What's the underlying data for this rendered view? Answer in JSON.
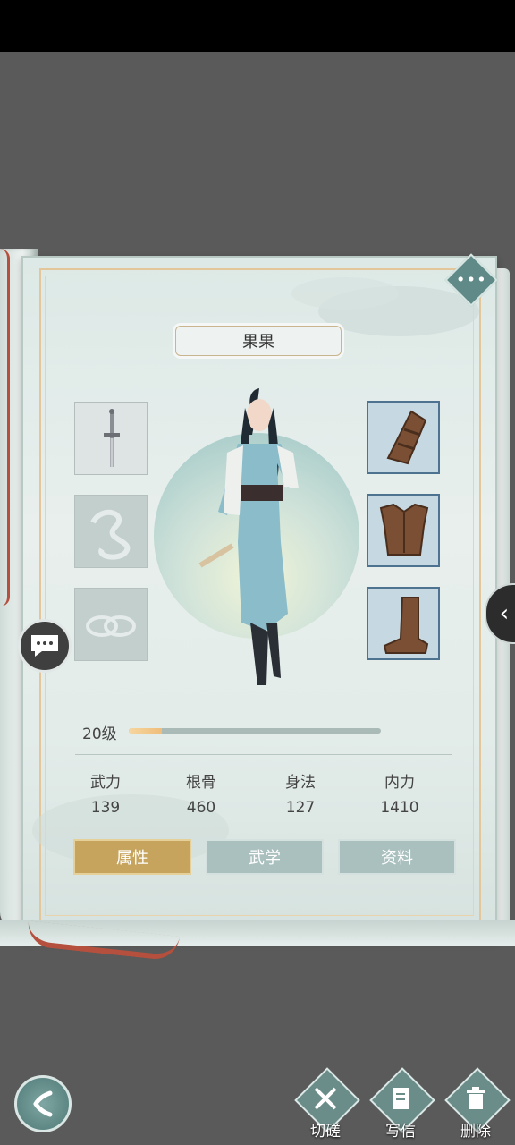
{
  "character": {
    "name": "果果"
  },
  "level": {
    "label": "20级",
    "progress": 0.13
  },
  "stats": [
    {
      "label": "武力",
      "value": "139"
    },
    {
      "label": "根骨",
      "value": "460"
    },
    {
      "label": "身法",
      "value": "127"
    },
    {
      "label": "内力",
      "value": "1410"
    }
  ],
  "tabs": [
    {
      "label": "属性",
      "active": true
    },
    {
      "label": "武学",
      "active": false
    },
    {
      "label": "资料",
      "active": false
    }
  ],
  "equipment": {
    "left": [
      "sword-icon",
      "accessory-icon",
      "rings-icon"
    ],
    "right": [
      "bracer-icon",
      "armor-icon",
      "boots-icon"
    ]
  },
  "actions": [
    {
      "label": "切磋",
      "icon": "crossed-swords-icon"
    },
    {
      "label": "写信",
      "icon": "letter-icon"
    },
    {
      "label": "删除",
      "icon": "trash-icon"
    }
  ],
  "colors": {
    "accent": "#c7a45d",
    "tab_inactive": "#a9c0bf",
    "slot_border": "#4d7390"
  }
}
